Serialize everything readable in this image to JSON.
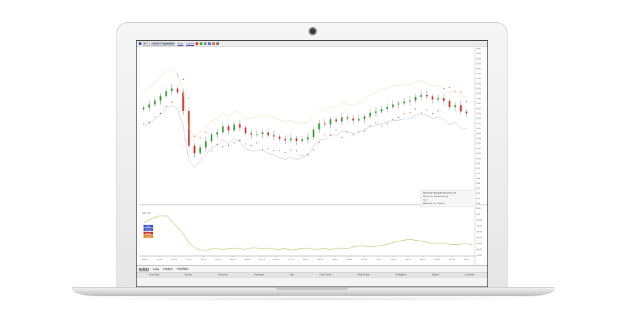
{
  "toolbar": {
    "symbol_box": "▾",
    "instrument": "Aktien / Tagesdaten",
    "link_1": "Extra",
    "link_2": "Ansicht"
  },
  "tabs": [
    "Orders",
    "Log",
    "Trades",
    "Portfolio"
  ],
  "columns": [
    "Kontrakt",
    "Aktion",
    "Volumen",
    "Ordertyp",
    "Typ",
    "Limit Preis",
    "Stop Preis",
    "Gültigkeit",
    "Status",
    "Löschen"
  ],
  "legend": {
    "title": "QQQ DAILY Parabolic Stop (0.02, 0.2)",
    "line1": "SMA (5, 2.0) · EMA Envelope (5)",
    "line2": "Close",
    "line3": "BBands (20, 2.0) · SMA (14)"
  },
  "side_labels": [
    "Kauf",
    "Verkauf",
    "Ausst.",
    "Auswahl"
  ],
  "lower_panel_label": "ADX (14)",
  "colors": {
    "up_candle": "#2f9a2f",
    "down_candle": "#d62a1f",
    "sar": "#e0241b",
    "envelope_upper": "#e8d08a",
    "envelope_lower": "#9aa0d8",
    "indicator": "#8cc43a",
    "button_blue": "#3b55c4",
    "button_red": "#c8342a",
    "button_orange": "#e08a1e"
  },
  "chart_data": {
    "type": "candlestick",
    "x_ticks": [
      "Mrz 13",
      "Apr 13",
      "Mai 13",
      "Jun 13",
      "Jul 13",
      "Aug 13",
      "Sep 13",
      "Okt 13",
      "Nov 13",
      "Dez 13",
      "Jan 14",
      "Feb 14",
      "Mrz 14",
      "Apr 14",
      "Mai 14",
      "Jun 14",
      "Jul 14",
      "Aug 14",
      "Sep 14",
      "Okt 14",
      "Nov 14",
      "Dez 14",
      "Jan 15"
    ],
    "y_ticks": [
      "32.00",
      "31.00",
      "30.00",
      "29.00",
      "28.00",
      "27.00",
      "26.00",
      "25.00",
      "24.00",
      "23.00",
      "22.00",
      "21.00",
      "20.00",
      "19.00",
      "18.00",
      "17.00",
      "16.00",
      "15.00",
      "14.00",
      "13.00",
      "12.00",
      "11.00",
      "10.00",
      "9.00",
      "8.00",
      "7.00",
      "6.00",
      "5.00",
      "4.00",
      "3.00",
      "2.00",
      "1.00"
    ],
    "price_path": [
      20.2,
      20.8,
      21.6,
      22.5,
      23.5,
      24.0,
      23.2,
      19.5,
      12.5,
      11.0,
      12.2,
      13.4,
      14.8,
      15.2,
      16.4,
      15.6,
      16.8,
      16.2,
      15.0,
      14.8,
      14.9,
      15.2,
      14.6,
      14.4,
      13.9,
      13.6,
      14.0,
      13.5,
      13.8,
      14.2,
      15.8,
      17.0,
      16.8,
      17.8,
      17.4,
      18.2,
      18.0,
      17.6,
      17.9,
      18.4,
      19.1,
      19.4,
      19.9,
      20.3,
      20.8,
      21.0,
      21.4,
      21.6,
      22.3,
      22.7,
      22.4,
      21.8,
      22.1,
      21.5,
      20.3,
      20.7,
      19.4,
      19.0
    ],
    "indicator_label": "ADX (14)",
    "indicator_ticks": [
      "10.00",
      "0.00",
      "-10.00",
      "-20.00",
      "-30.00",
      "-40.00",
      "-50.00",
      "-60.00",
      "-70.00"
    ],
    "indicator_path": [
      -15,
      -8,
      -3,
      -3,
      -18,
      -32,
      -52,
      -60,
      -62,
      -58,
      -60,
      -59,
      -58,
      -60,
      -57,
      -59,
      -58,
      -60,
      -59,
      -61,
      -59,
      -58,
      -60,
      -59,
      -60,
      -58,
      -59,
      -55,
      -54,
      -56,
      -54,
      -52,
      -48,
      -45,
      -43,
      -45,
      -47,
      -50,
      -49,
      -51,
      -52,
      -50,
      -52
    ]
  }
}
